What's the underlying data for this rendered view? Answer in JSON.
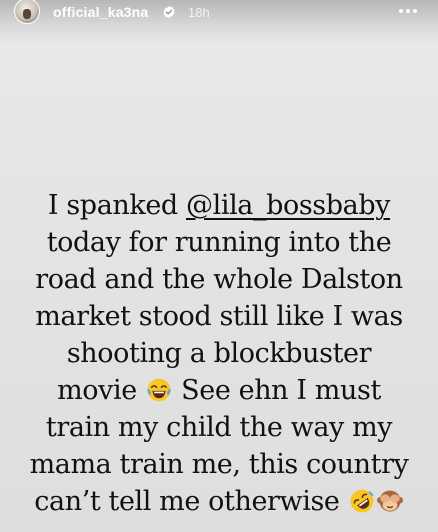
{
  "header": {
    "username": "official_ka3na",
    "time": "18h"
  },
  "story": {
    "line1_before": "I spanked ",
    "mention": "@lila_bossbaby",
    "line2": "today for running into the",
    "line3": "road and the whole Dalston",
    "line4": "market stood still like I was",
    "line5": "shooting a blockbuster",
    "line6_before": "movie ",
    "line6_after": " See ehn I must",
    "line7": "train my child the way my",
    "line8": "mama train me, this country",
    "line9": "can’t tell me otherwise "
  },
  "icons": {
    "verified": "verified-badge-icon",
    "more": "more-options-icon",
    "emoji_1": "face-with-tears-of-joy-emoji",
    "emoji_2": "rolling-on-floor-laughing-emoji",
    "emoji_3": "see-no-evil-monkey-emoji"
  },
  "colors": {
    "background": "#e4e4e4",
    "text": "#111111",
    "header_text": "#ffffff"
  }
}
